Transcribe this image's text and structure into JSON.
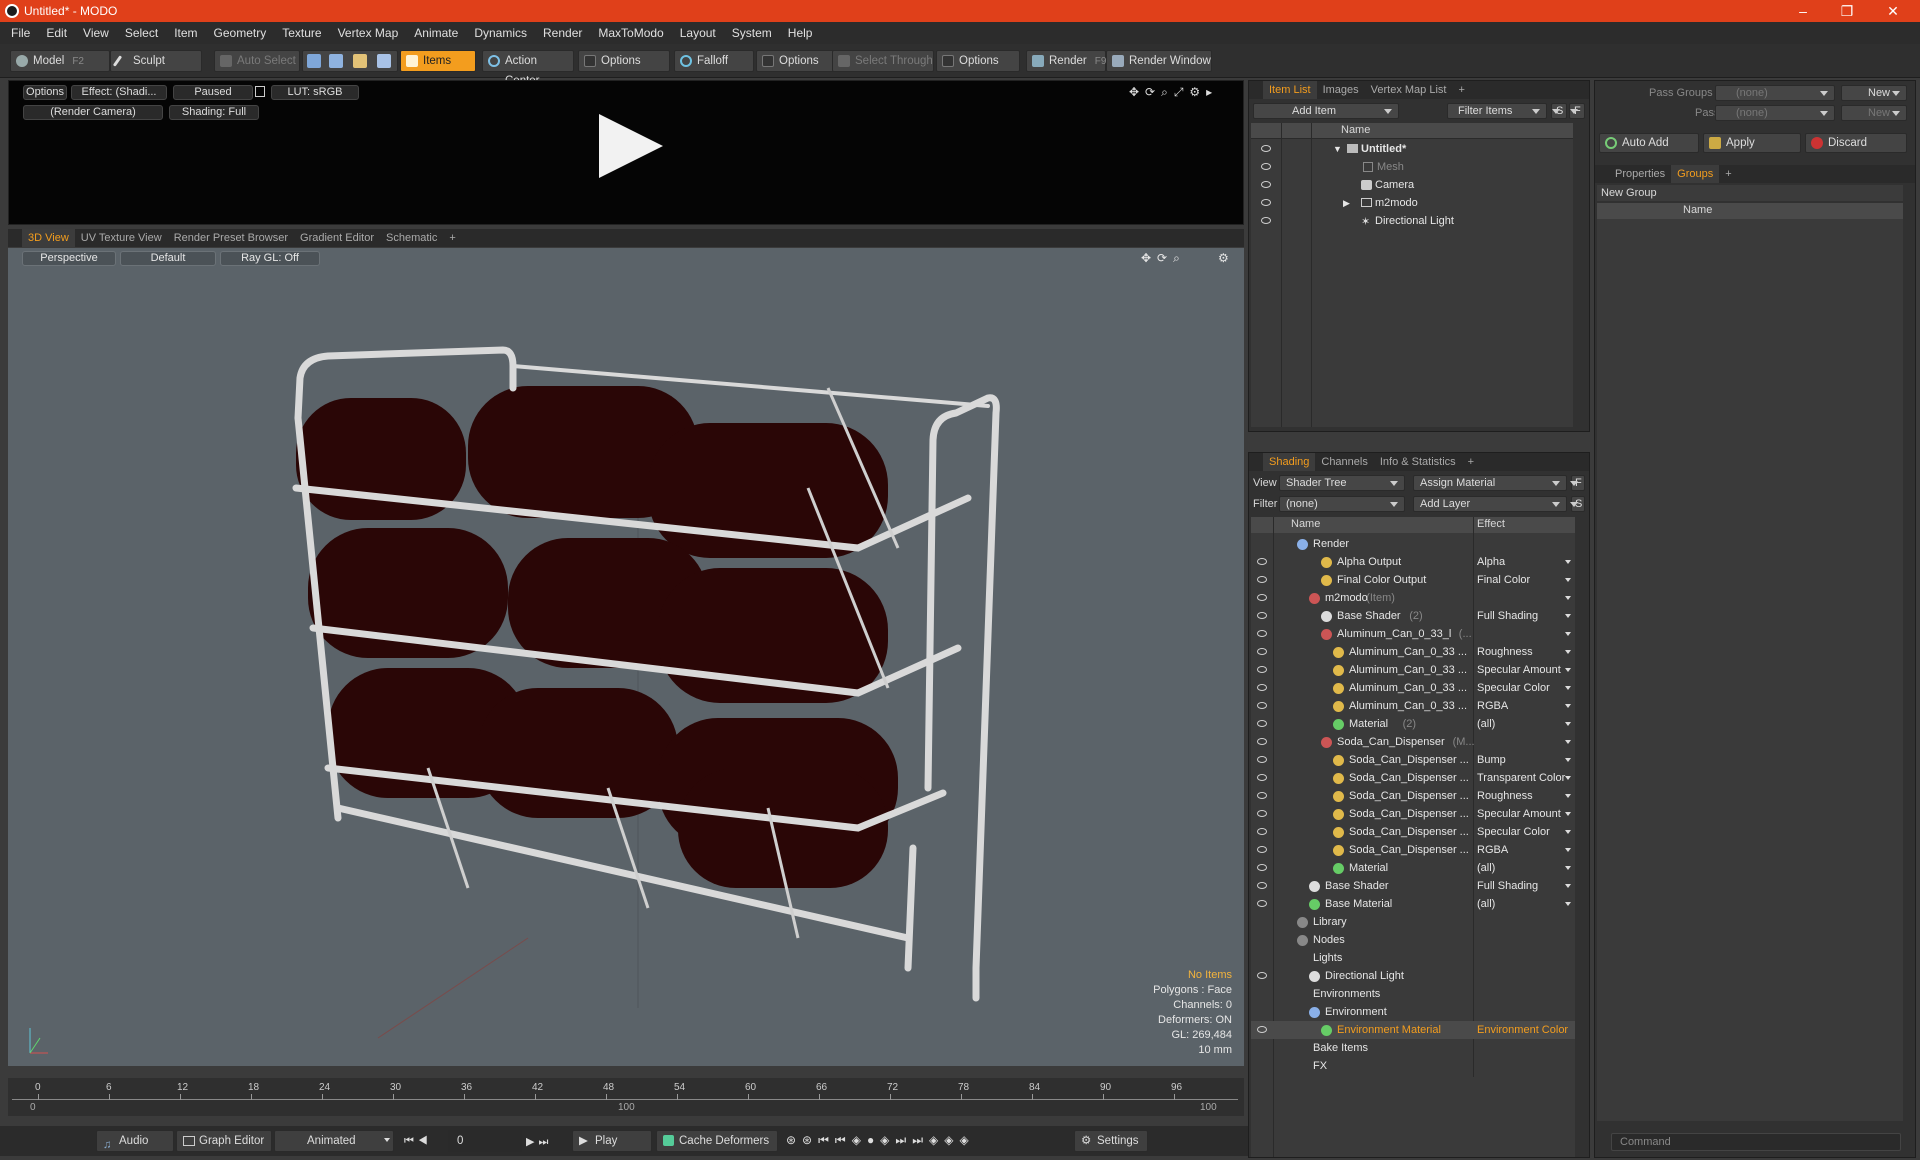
{
  "window": {
    "title": "Untitled* - MODO",
    "controls": [
      "–",
      "❐",
      "✕"
    ]
  },
  "menu": [
    "File",
    "Edit",
    "View",
    "Select",
    "Item",
    "Geometry",
    "Texture",
    "Vertex Map",
    "Animate",
    "Dynamics",
    "Render",
    "MaxToModo",
    "Layout",
    "System",
    "Help"
  ],
  "toolbar": {
    "model": "Model",
    "model_key": "F2",
    "sculpt": "Sculpt",
    "auto_select": "Auto Select",
    "items": "Items",
    "action_center": "Action Center",
    "options1": "Options",
    "falloff": "Falloff",
    "options2": "Options",
    "select_through": "Select Through",
    "options3": "Options",
    "render": "Render",
    "render_key": "F9",
    "render_window": "Render Window"
  },
  "preview": {
    "options": "Options",
    "effect": "Effect: (Shadi...",
    "paused": "Paused",
    "lut": "LUT: sRGB",
    "camera": "(Render Camera)",
    "shading": "Shading: Full"
  },
  "view_tabs": [
    "3D View",
    "UV Texture View",
    "Render Preset Browser",
    "Gradient Editor",
    "Schematic",
    "+"
  ],
  "viewport": {
    "perspective": "Perspective",
    "default": "Default",
    "raygl": "Ray GL: Off",
    "stats": {
      "no_items": "No Items",
      "polygons": "Polygons : Face",
      "channels": "Channels: 0",
      "deformers": "Deformers: ON",
      "gl": "GL: 269,484",
      "scale": "10 mm"
    }
  },
  "timeline": {
    "ticks": [
      "0",
      "6",
      "12",
      "18",
      "24",
      "30",
      "36",
      "42",
      "48",
      "54",
      "60",
      "66",
      "72",
      "78",
      "84",
      "90",
      "96"
    ],
    "start": "0",
    "mid": "100",
    "end": "100"
  },
  "bottom": {
    "audio": "Audio",
    "graph_editor": "Graph Editor",
    "animated": "Animated",
    "frame": "0",
    "play": "Play",
    "cache": "Cache Deformers",
    "settings": "Settings"
  },
  "item_list": {
    "tabs": [
      "Item List",
      "Images",
      "Vertex Map List",
      "+"
    ],
    "add_item": "Add Item",
    "filter_items": "Filter Items",
    "s": "S",
    "f": "F",
    "col_name": "Name",
    "rows": [
      {
        "label": "Untitled*",
        "bold": true
      },
      {
        "label": "Mesh",
        "dim": true
      },
      {
        "label": "Camera"
      },
      {
        "label": "m2modo"
      },
      {
        "label": "Directional Light"
      }
    ]
  },
  "groups_panel": {
    "pass_groups": "Pass Groups",
    "passes": "Passes",
    "none1": "(none)",
    "none2": "(none)",
    "new1": "New",
    "new2": "New",
    "auto_add": "Auto Add",
    "apply": "Apply",
    "discard": "Discard",
    "tabs": [
      "Properties",
      "Groups",
      "+"
    ],
    "new_group": "New Group",
    "col_name": "Name",
    "command": "Command"
  },
  "shading": {
    "tabs": [
      "Shading",
      "Channels",
      "Info & Statistics",
      "+"
    ],
    "view_label": "View",
    "view_value": "Shader Tree",
    "assign_material": "Assign Material",
    "f": "F",
    "filter_label": "Filter",
    "filter_value": "(none)",
    "add_layer": "Add Layer",
    "s": "S",
    "col_name": "Name",
    "col_effect": "Effect",
    "rows": [
      {
        "label": "Render",
        "effect": ""
      },
      {
        "label": "Alpha Output",
        "effect": "Alpha"
      },
      {
        "label": "Final Color Output",
        "effect": "Final Color"
      },
      {
        "label": "m2modo",
        "suffix": "(Item)",
        "effect": ""
      },
      {
        "label": "Base Shader",
        "suffix": "(2)",
        "effect": "Full Shading"
      },
      {
        "label": "Aluminum_Can_0_33_l",
        "suffix": "(...",
        "effect": ""
      },
      {
        "label": "Aluminum_Can_0_33 ...",
        "effect": "Roughness"
      },
      {
        "label": "Aluminum_Can_0_33 ...",
        "effect": "Specular Amount"
      },
      {
        "label": "Aluminum_Can_0_33 ...",
        "effect": "Specular Color"
      },
      {
        "label": "Aluminum_Can_0_33 ...",
        "effect": "RGBA"
      },
      {
        "label": "Material",
        "suffix": "(2)",
        "effect": "(all)"
      },
      {
        "label": "Soda_Can_Dispenser",
        "suffix": "(M...",
        "effect": ""
      },
      {
        "label": "Soda_Can_Dispenser ...",
        "effect": "Bump"
      },
      {
        "label": "Soda_Can_Dispenser ...",
        "effect": "Transparent Color"
      },
      {
        "label": "Soda_Can_Dispenser ...",
        "effect": "Roughness"
      },
      {
        "label": "Soda_Can_Dispenser ...",
        "effect": "Specular Amount"
      },
      {
        "label": "Soda_Can_Dispenser ...",
        "effect": "Specular Color"
      },
      {
        "label": "Soda_Can_Dispenser ...",
        "effect": "RGBA"
      },
      {
        "label": "Material",
        "effect": "(all)"
      },
      {
        "label": "Base Shader",
        "effect": "Full Shading"
      },
      {
        "label": "Base Material",
        "effect": "(all)"
      },
      {
        "label": "Library",
        "effect": ""
      },
      {
        "label": "Nodes",
        "effect": ""
      },
      {
        "label": "Lights",
        "effect": ""
      },
      {
        "label": "Directional Light",
        "effect": ""
      },
      {
        "label": "Environments",
        "effect": ""
      },
      {
        "label": "Environment",
        "effect": ""
      },
      {
        "label": "Environment Material",
        "effect": "Environment Color"
      },
      {
        "label": "Bake Items",
        "effect": ""
      },
      {
        "label": "FX",
        "effect": ""
      }
    ]
  },
  "colors": {
    "accent": "#f39d1e",
    "title_bar": "#e0401a",
    "can": "#2a0606",
    "rack": "#d9d9d9",
    "viewport": "#5b6369"
  }
}
